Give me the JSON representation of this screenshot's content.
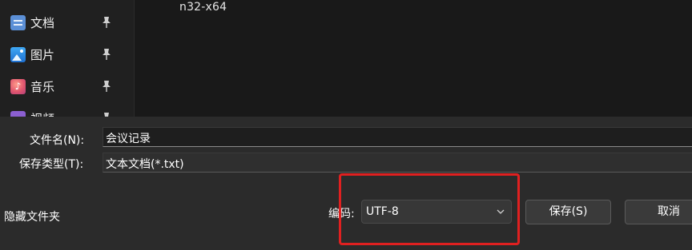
{
  "file_list": {
    "partial_item_text": "n32-x64"
  },
  "nav": {
    "items": [
      {
        "label": "文档",
        "icon": "documents-icon"
      },
      {
        "label": "图片",
        "icon": "pictures-icon"
      },
      {
        "label": "音乐",
        "icon": "music-icon"
      },
      {
        "label": "视频",
        "icon": "videos-icon"
      }
    ],
    "pin_icon": "pin-icon"
  },
  "save_panel": {
    "filename_label": "文件名(N):",
    "filename_value": "会议记录",
    "filetype_label": "保存类型(T):",
    "filetype_value": "文本文档(*.txt)",
    "hide_folders_label": "隐藏文件夹",
    "encoding_label": "编码:",
    "encoding_value": "UTF-8",
    "save_button": "保存(S)",
    "cancel_button": "取消"
  },
  "colors": {
    "highlight": "#e02020",
    "panel_bg": "#2b2b2b",
    "list_bg": "#191919"
  }
}
